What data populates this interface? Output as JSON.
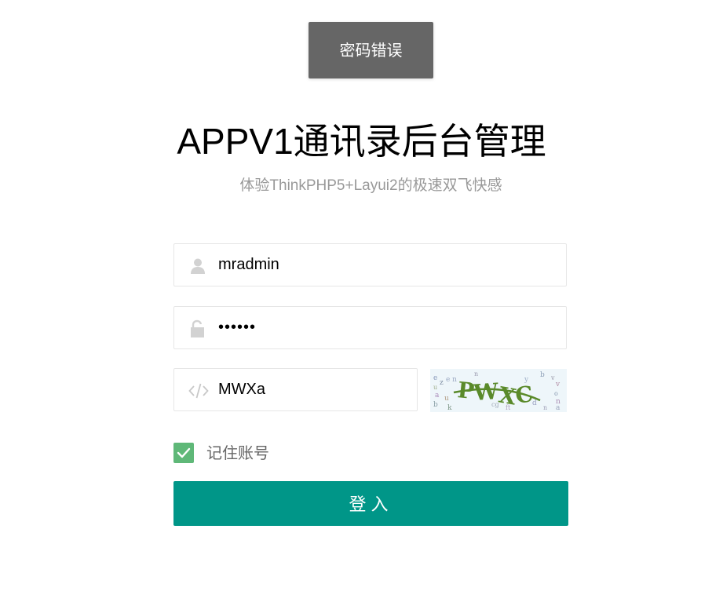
{
  "toast": {
    "message": "密码错误"
  },
  "header": {
    "title": "APPV1通讯录后台管理",
    "subtitle": "体验ThinkPHP5+Layui2的极速双飞快感"
  },
  "form": {
    "username": {
      "value": "mradmin",
      "icon": "user-icon"
    },
    "password": {
      "value": "••••••",
      "icon": "lock-icon"
    },
    "captcha": {
      "value": "MWXa",
      "icon": "code-icon",
      "image_text": "PWXC"
    },
    "remember": {
      "label": "记住账号",
      "checked": true
    },
    "submit_label": "登入"
  },
  "colors": {
    "primary": "#009688",
    "checkbox": "#5FB878",
    "toast_bg": "#666666",
    "muted_text": "#999999",
    "border": "#E6E6E6"
  }
}
